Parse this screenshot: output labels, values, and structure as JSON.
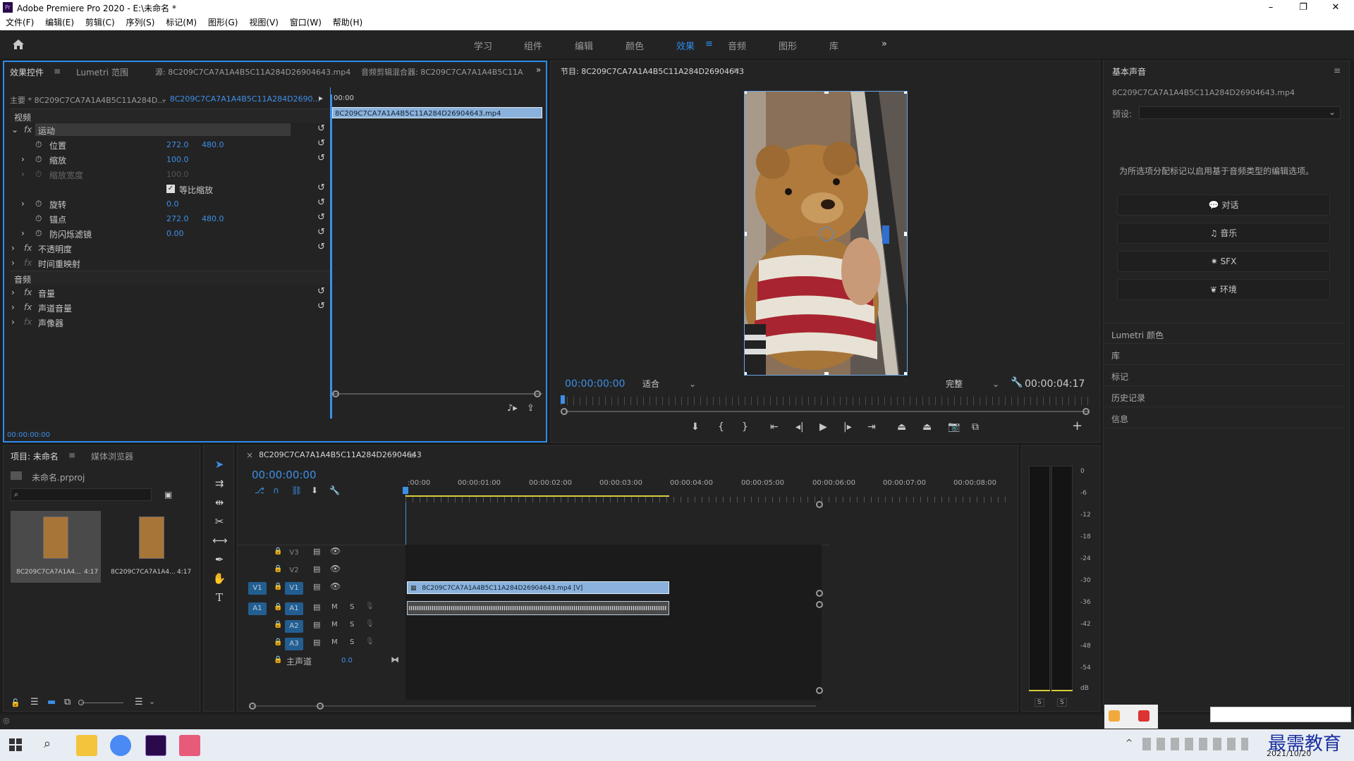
{
  "app": {
    "title": "Adobe Premiere Pro 2020 - E:\\未命名 *",
    "icon_label": "Pr",
    "window_controls": [
      "–",
      "❐",
      "✕"
    ]
  },
  "menu": [
    "文件(F)",
    "编辑(E)",
    "剪辑(C)",
    "序列(S)",
    "标记(M)",
    "图形(G)",
    "视图(V)",
    "窗口(W)",
    "帮助(H)"
  ],
  "workspaces": [
    "学习",
    "组件",
    "编辑",
    "颜色",
    "效果",
    "音频",
    "图形",
    "库"
  ],
  "active_workspace": "效果",
  "effect_controls": {
    "tabs": [
      "效果控件",
      "Lumetri 范围",
      "源: 8C209C7CA7A1A4B5C11A284D26904643.mp4",
      "音频剪辑混合器: 8C209C7CA7A1A4B5C11A"
    ],
    "master_label": "主要 * 8C209C7CA7A1A4B5C11A284D...",
    "sequence_label": "8C209C7CA7A1A4B5C11A284D2690...",
    "mini_time": "00:00",
    "clip_name": "8C209C7CA7A1A4B5C11A284D26904643.mp4",
    "video_header": "视频",
    "audio_header": "音频",
    "motion": "运动",
    "position_label": "位置",
    "position_x": "272.0",
    "position_y": "480.0",
    "scale_label": "缩放",
    "scale": "100.0",
    "scale_width_label": "缩放宽度",
    "scale_width": "100.0",
    "uniform_label": "等比缩放",
    "rotation_label": "旋转",
    "rotation": "0.0",
    "anchor_label": "锚点",
    "anchor_x": "272.0",
    "anchor_y": "480.0",
    "flicker_label": "防闪烁滤镜",
    "flicker": "0.00",
    "opacity": "不透明度",
    "time_remap": "时间重映射",
    "volume": "音量",
    "channel_volume": "声道音量",
    "panner": "声像器",
    "timecode": "00:00:00:00"
  },
  "program": {
    "title": "节目: 8C209C7CA7A1A4B5C11A284D26904643",
    "timecode": "00:00:00:00",
    "fit": "适合",
    "quality": "完整",
    "duration": "00:00:04:17"
  },
  "essential_sound": {
    "title": "基本声音",
    "file": "8C209C7CA7A1A4B5C11A284D26904643.mp4",
    "preset_label": "预设:",
    "hint": "为所选项分配标记以启用基于音频类型的编辑选项。",
    "buttons": [
      "对话",
      "音乐",
      "SFX",
      "环境"
    ],
    "sections": [
      "Lumetri 颜色",
      "库",
      "标记",
      "历史记录",
      "信息"
    ]
  },
  "project": {
    "tabs": [
      "项目: 未命名",
      "媒体浏览器"
    ],
    "file": "未命名.prproj",
    "items": [
      {
        "name": "8C209C7CA7A1A4...",
        "duration": "4:17"
      },
      {
        "name": "8C209C7CA7A1A4...",
        "duration": "4:17"
      }
    ]
  },
  "timeline": {
    "tab": "8C209C7CA7A1A4B5C11A284D26904643",
    "timecode": "00:00:00:00",
    "ruler": [
      ":00:00",
      "00:00:01:00",
      "00:00:02:00",
      "00:00:03:00",
      "00:00:04:00",
      "00:00:05:00",
      "00:00:06:00",
      "00:00:07:00",
      "00:00:08:00"
    ],
    "tracks": {
      "v3": "V3",
      "v2": "V2",
      "v1": "V1",
      "a1": "A1",
      "a2": "A2",
      "a3": "A3",
      "mute": "M",
      "solo": "S",
      "master": "主声道",
      "master_value": "0.0"
    },
    "video_clip": "8C209C7CA7A1A4B5C11A284D26904643.mp4 [V]"
  },
  "audio_meter": {
    "scale": [
      "0",
      "-6",
      "-12",
      "-18",
      "-24",
      "-30",
      "-36",
      "-42",
      "-48",
      "-54",
      "dB"
    ],
    "solo": [
      "S",
      "S"
    ]
  },
  "taskbar": {
    "date": "2021/10/20",
    "watermark": "最需教育"
  },
  "colors": {
    "accent": "#2d8ceb",
    "clip_video": "#8ab2dc",
    "panel_bg": "#232323"
  }
}
